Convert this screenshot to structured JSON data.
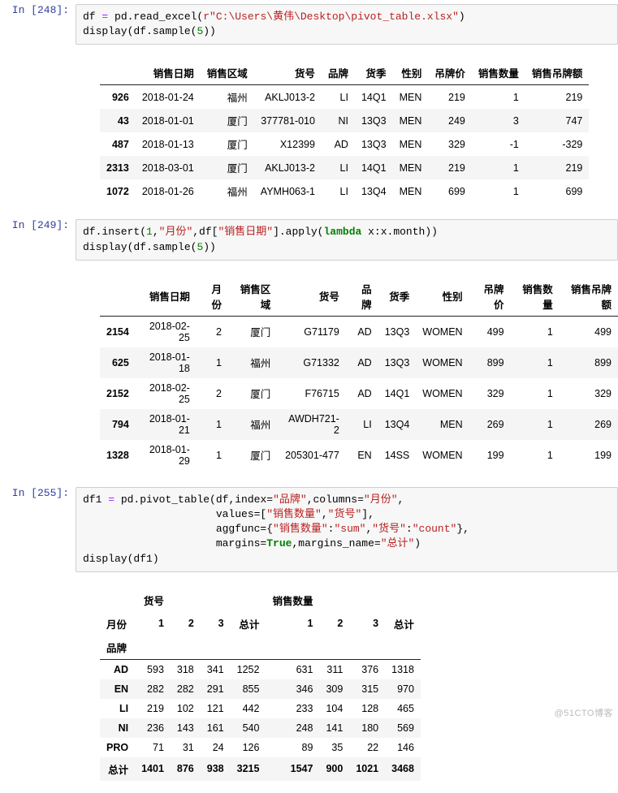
{
  "watermark": "@51CTO博客",
  "cells": {
    "c1": {
      "prompt": "In [248]:",
      "code_html": "df <span class='c-op'>=</span> pd.read_excel(<span class='c-raw'>r\"C:\\Users\\黄伟\\Desktop\\pivot_table.xlsx\"</span>)\ndisplay(df.sample(<span class='c-num'>5</span>))"
    },
    "c2": {
      "prompt": "In [249]:",
      "code_html": "df.insert(<span class='c-num'>1</span>,<span class='c-str'>\"月份\"</span>,df[<span class='c-str'>\"销售日期\"</span>].apply(<span class='c-kw'>lambda</span> x:x.month))\ndisplay(df.sample(<span class='c-num'>5</span>))"
    },
    "c3": {
      "prompt": "In [255]:",
      "code_html": "df1 <span class='c-op'>=</span> pd.pivot_table(df,index=<span class='c-str'>\"品牌\"</span>,columns=<span class='c-str'>\"月份\"</span>,\n                     values=[<span class='c-str'>\"销售数量\"</span>,<span class='c-str'>\"货号\"</span>],\n                     aggfunc={<span class='c-str'>\"销售数量\"</span>:<span class='c-str'>\"sum\"</span>,<span class='c-str'>\"货号\"</span>:<span class='c-str'>\"count\"</span>},\n                     margins=<span class='c-kw'>True</span>,margins_name=<span class='c-str'>\"总计\"</span>)\ndisplay(df1)"
    }
  },
  "table1": {
    "headers": [
      "",
      "销售日期",
      "销售区域",
      "货号",
      "品牌",
      "货季",
      "性别",
      "吊牌价",
      "销售数量",
      "销售吊牌额"
    ],
    "rows": [
      [
        "926",
        "2018-01-24",
        "福州",
        "AKLJ013-2",
        "LI",
        "14Q1",
        "MEN",
        "219",
        "1",
        "219"
      ],
      [
        "43",
        "2018-01-01",
        "厦门",
        "377781-010",
        "NI",
        "13Q3",
        "MEN",
        "249",
        "3",
        "747"
      ],
      [
        "487",
        "2018-01-13",
        "厦门",
        "X12399",
        "AD",
        "13Q3",
        "MEN",
        "329",
        "-1",
        "-329"
      ],
      [
        "2313",
        "2018-03-01",
        "厦门",
        "AKLJ013-2",
        "LI",
        "14Q1",
        "MEN",
        "219",
        "1",
        "219"
      ],
      [
        "1072",
        "2018-01-26",
        "福州",
        "AYMH063-1",
        "LI",
        "13Q4",
        "MEN",
        "699",
        "1",
        "699"
      ]
    ]
  },
  "table2": {
    "headers": [
      "",
      "销售日期",
      "月份",
      "销售区域",
      "货号",
      "品牌",
      "货季",
      "性别",
      "吊牌价",
      "销售数量",
      "销售吊牌额"
    ],
    "rows": [
      [
        "2154",
        "2018-02-25",
        "2",
        "厦门",
        "G71179",
        "AD",
        "13Q3",
        "WOMEN",
        "499",
        "1",
        "499"
      ],
      [
        "625",
        "2018-01-18",
        "1",
        "福州",
        "G71332",
        "AD",
        "13Q3",
        "WOMEN",
        "899",
        "1",
        "899"
      ],
      [
        "2152",
        "2018-02-25",
        "2",
        "厦门",
        "F76715",
        "AD",
        "14Q1",
        "WOMEN",
        "329",
        "1",
        "329"
      ],
      [
        "794",
        "2018-01-21",
        "1",
        "福州",
        "AWDH721-2",
        "LI",
        "13Q4",
        "MEN",
        "269",
        "1",
        "269"
      ],
      [
        "1328",
        "2018-01-29",
        "1",
        "厦门",
        "205301-477",
        "EN",
        "14SS",
        "WOMEN",
        "199",
        "1",
        "199"
      ]
    ]
  },
  "table3": {
    "top": [
      "",
      "货号",
      "",
      "",
      "",
      "销售数量",
      "",
      "",
      ""
    ],
    "mid": [
      "月份",
      "1",
      "2",
      "3",
      "总计",
      "1",
      "2",
      "3",
      "总计"
    ],
    "bot": [
      "品牌",
      "",
      "",
      "",
      "",
      "",
      "",
      "",
      ""
    ],
    "rows": [
      [
        "AD",
        "593",
        "318",
        "341",
        "1252",
        "631",
        "311",
        "376",
        "1318"
      ],
      [
        "EN",
        "282",
        "282",
        "291",
        "855",
        "346",
        "309",
        "315",
        "970"
      ],
      [
        "LI",
        "219",
        "102",
        "121",
        "442",
        "233",
        "104",
        "128",
        "465"
      ],
      [
        "NI",
        "236",
        "143",
        "161",
        "540",
        "248",
        "141",
        "180",
        "569"
      ],
      [
        "PRO",
        "71",
        "31",
        "24",
        "126",
        "89",
        "35",
        "22",
        "146"
      ],
      [
        "总计",
        "1401",
        "876",
        "938",
        "3215",
        "1547",
        "900",
        "1021",
        "3468"
      ]
    ]
  }
}
